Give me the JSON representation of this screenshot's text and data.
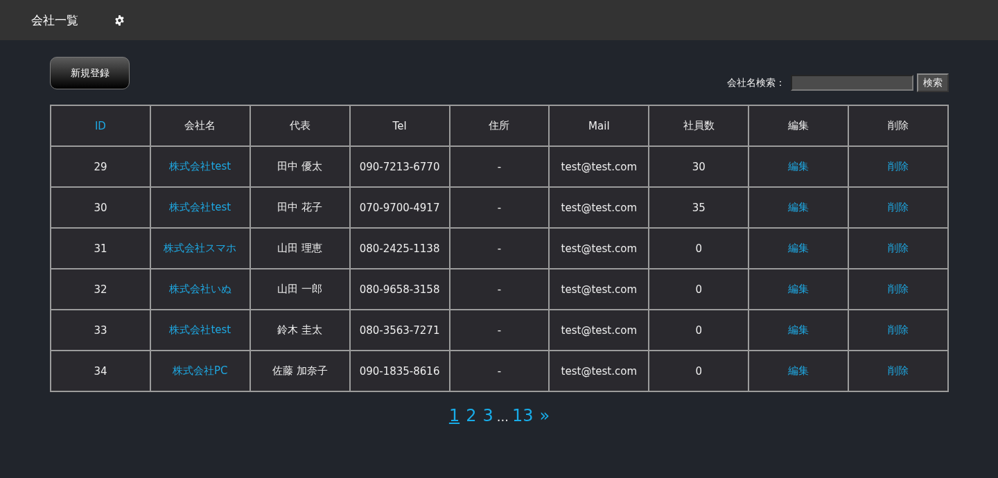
{
  "header": {
    "title": "会社一覧"
  },
  "toolbar": {
    "new_button": "新規登録",
    "search": {
      "label": "会社名検索：",
      "button": "検索"
    }
  },
  "table": {
    "columns": [
      {
        "label": "ID",
        "sortable": true,
        "kind": "text"
      },
      {
        "label": "会社名",
        "sortable": false,
        "kind": "link"
      },
      {
        "label": "代表",
        "sortable": false,
        "kind": "text"
      },
      {
        "label": "Tel",
        "sortable": false,
        "kind": "text"
      },
      {
        "label": "住所",
        "sortable": false,
        "kind": "text"
      },
      {
        "label": "Mail",
        "sortable": false,
        "kind": "text"
      },
      {
        "label": "社員数",
        "sortable": false,
        "kind": "text"
      },
      {
        "label": "編集",
        "sortable": false,
        "kind": "link"
      },
      {
        "label": "削除",
        "sortable": false,
        "kind": "link"
      }
    ],
    "rows": [
      [
        "29",
        "株式会社test",
        "田中 優太",
        "090-7213-6770",
        "-",
        "test@test.com",
        "30",
        "編集",
        "削除"
      ],
      [
        "30",
        "株式会社test",
        "田中 花子",
        "070-9700-4917",
        "-",
        "test@test.com",
        "35",
        "編集",
        "削除"
      ],
      [
        "31",
        "株式会社スマホ",
        "山田 理恵",
        "080-2425-1138",
        "-",
        "test@test.com",
        "0",
        "編集",
        "削除"
      ],
      [
        "32",
        "株式会社いぬ",
        "山田 一郎",
        "080-9658-3158",
        "-",
        "test@test.com",
        "0",
        "編集",
        "削除"
      ],
      [
        "33",
        "株式会社test",
        "鈴木 圭太",
        "080-3563-7271",
        "-",
        "test@test.com",
        "0",
        "編集",
        "削除"
      ],
      [
        "34",
        "株式会社PC",
        "佐藤 加奈子",
        "090-1835-8616",
        "-",
        "test@test.com",
        "0",
        "編集",
        "削除"
      ]
    ]
  },
  "pagination": [
    {
      "kind": "page",
      "label": "1",
      "selected": true
    },
    {
      "kind": "page",
      "label": "2",
      "selected": false
    },
    {
      "kind": "page",
      "label": "3",
      "selected": false
    },
    {
      "kind": "gap",
      "label": "..."
    },
    {
      "kind": "page",
      "label": "13",
      "selected": false
    },
    {
      "kind": "next",
      "label": "»"
    }
  ]
}
